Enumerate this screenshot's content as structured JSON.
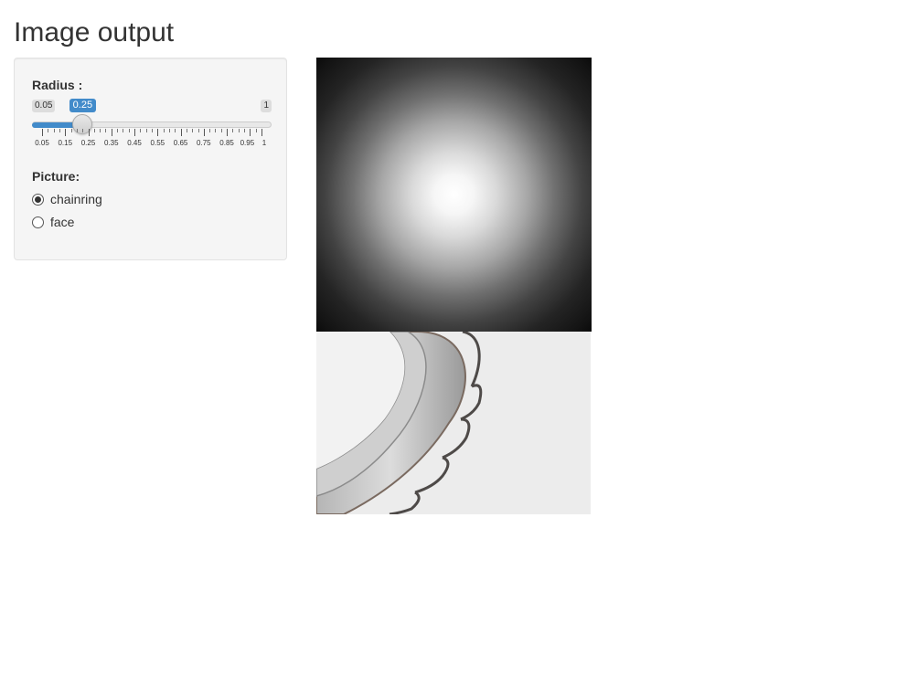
{
  "page": {
    "title": "Image output"
  },
  "radius": {
    "label": "Radius :",
    "min": 0.05,
    "max": 1,
    "value": 0.25,
    "min_text": "0.05",
    "max_text": "1",
    "value_text": "0.25",
    "ticks": [
      "0.05",
      "0.15",
      "0.25",
      "0.35",
      "0.45",
      "0.55",
      "0.65",
      "0.75",
      "0.85",
      "0.95",
      "1"
    ]
  },
  "picture": {
    "label": "Picture:",
    "options": [
      {
        "label": "chainring",
        "selected": true
      },
      {
        "label": "face",
        "selected": false
      }
    ]
  },
  "colors": {
    "accent": "#428bca",
    "panel_background": "#f5f5f5"
  }
}
